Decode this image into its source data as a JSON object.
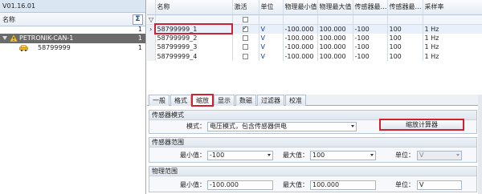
{
  "app": {
    "version": "V01.16.01"
  },
  "tree": {
    "header": "名称",
    "sigma": "Σ",
    "sigma_count": "1",
    "nodes": [
      {
        "label": "PETRONIK-CAN-1",
        "count": "1",
        "level": 0,
        "selected": true
      },
      {
        "label": "58799999",
        "count": "1",
        "level": 1,
        "selected": false
      }
    ]
  },
  "grid": {
    "columns": [
      "名称",
      "激活",
      "单位",
      "物理最小值",
      "物理最大值",
      "传感器最…",
      "传感器最…",
      "采样率"
    ],
    "rows": [
      {
        "name": "58799999_1",
        "active": true,
        "unit": "V",
        "phys_min": "-100.000",
        "phys_max": "100.000",
        "sensor_min": "-100",
        "sensor_max": "100",
        "rate": "1 Hz"
      },
      {
        "name": "58799999_2",
        "active": false,
        "unit": "V",
        "phys_min": "-100.000",
        "phys_max": "100.000",
        "sensor_min": "-100",
        "sensor_max": "100",
        "rate": "1 Hz"
      },
      {
        "name": "58799999_3",
        "active": false,
        "unit": "V",
        "phys_min": "-100.000",
        "phys_max": "100.000",
        "sensor_min": "-100",
        "sensor_max": "100",
        "rate": "1 Hz"
      },
      {
        "name": "58799999_4",
        "active": false,
        "unit": "V",
        "phys_min": "-100.000",
        "phys_max": "100.000",
        "sensor_min": "-100",
        "sensor_max": "100",
        "rate": "1 Hz"
      }
    ]
  },
  "tabs": [
    "一般",
    "格式",
    "缩放",
    "显示",
    "数磁",
    "过滤器",
    "校准"
  ],
  "active_tab": "缩放",
  "sensor_mode": {
    "title": "传感器模式",
    "mode_label": "模式：",
    "mode_value": "电压模式，包含传感器供电",
    "calc_button": "缩放计算器"
  },
  "sensor_range": {
    "title": "传感器范围",
    "min_label": "最小值：",
    "min_value": "-100",
    "max_label": "最大值：",
    "max_value": "100",
    "unit_label": "单位：",
    "unit_value": "V"
  },
  "phys_range": {
    "title": "物理范围",
    "min_label": "最小值：",
    "min_value": "-100.000",
    "max_label": "最大值：",
    "max_value": "100.000",
    "unit_label": "单位：",
    "unit_value": "V"
  },
  "colors": {
    "highlight": "#d2202f",
    "selected_tree": "#6a6a6a",
    "header_bg": "#dbe6f3"
  }
}
